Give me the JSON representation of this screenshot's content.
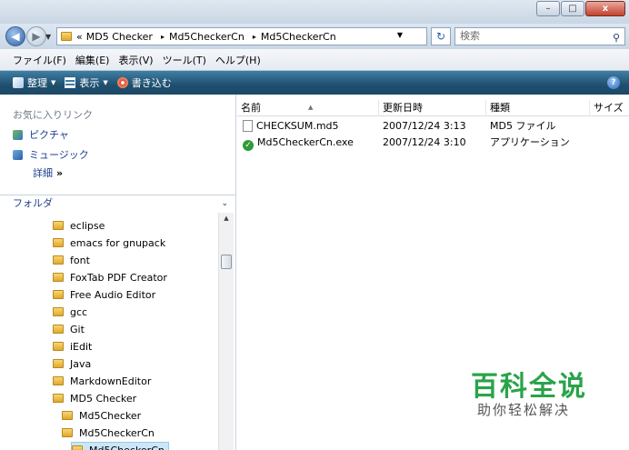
{
  "window": {
    "controls": [
      "–",
      "□",
      "x"
    ]
  },
  "address": {
    "prefix": "«",
    "crumbs": [
      "MD5 Checker",
      "Md5CheckerCn",
      "Md5CheckerCn"
    ],
    "separator": "▸",
    "search_placeholder": "検索"
  },
  "menu": [
    "ファイル(F)",
    "編集(E)",
    "表示(V)",
    "ツール(T)",
    "ヘルプ(H)"
  ],
  "toolbar": {
    "organize": "整理",
    "views": "表示",
    "burn": "書き込む",
    "help": "?"
  },
  "leftnav": {
    "favorites_title": "お気に入りリンク",
    "favorites": [
      "ピクチャ",
      "ミュージック"
    ],
    "more": "詳細",
    "more_glyph": "»",
    "folders_title": "フォルダ",
    "tree": [
      {
        "label": "eclipse",
        "level": 1
      },
      {
        "label": "emacs for gnupack",
        "level": 1
      },
      {
        "label": "font",
        "level": 1
      },
      {
        "label": "FoxTab PDF Creator",
        "level": 1
      },
      {
        "label": "Free Audio Editor",
        "level": 1
      },
      {
        "label": "gcc",
        "level": 1
      },
      {
        "label": "Git",
        "level": 1
      },
      {
        "label": "iEdit",
        "level": 1
      },
      {
        "label": "Java",
        "level": 1
      },
      {
        "label": "MarkdownEditor",
        "level": 1
      },
      {
        "label": "MD5 Checker",
        "level": 1
      },
      {
        "label": "Md5Checker",
        "level": 2
      },
      {
        "label": "Md5CheckerCn",
        "level": 2
      },
      {
        "label": "Md5CheckerCn",
        "level": 3,
        "selected": true
      }
    ]
  },
  "main": {
    "columns": [
      "名前",
      "更新日時",
      "種類",
      "サイズ"
    ],
    "files": [
      {
        "name": "CHECKSUM.md5",
        "date": "2007/12/24 3:13",
        "type": "MD5 ファイル",
        "icon": "document-icon"
      },
      {
        "name": "Md5CheckerCn.exe",
        "date": "2007/12/24 3:10",
        "type": "アプリケーション",
        "icon": "checkmark-app-icon"
      }
    ]
  },
  "watermark": {
    "title": "百科全说",
    "subtitle": "助你轻松解决"
  }
}
